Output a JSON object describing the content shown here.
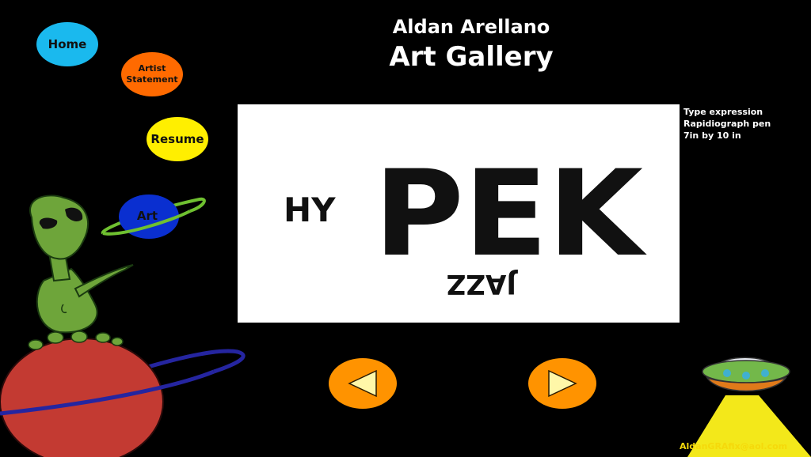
{
  "header": {
    "artist_name": "Aldan Arellano",
    "gallery_title": "Art Gallery"
  },
  "nav": {
    "home": "Home",
    "artist_statement_line1": "Artist",
    "artist_statement_line2": "Statement",
    "resume": "Resume",
    "art": "Art"
  },
  "artwork": {
    "caption_line1": "Type expression",
    "caption_line2": "Rapidiograph pen",
    "caption_line3": "7in by 10 in",
    "text_left": "HY",
    "text_main": "PEK",
    "text_bottom": "JAZZ"
  },
  "controls": {
    "prev_icon": "left-triangle",
    "next_icon": "right-triangle"
  },
  "footer": {
    "email": "AldanGRAfix@aol.com"
  },
  "colors": {
    "background": "#000000",
    "home": "#1ab9ee",
    "artist_statement": "#ff6a00",
    "resume": "#ffef00",
    "art_planet": "#0a2fd0",
    "arrow": "#ff9300",
    "email": "#f5d90b"
  }
}
